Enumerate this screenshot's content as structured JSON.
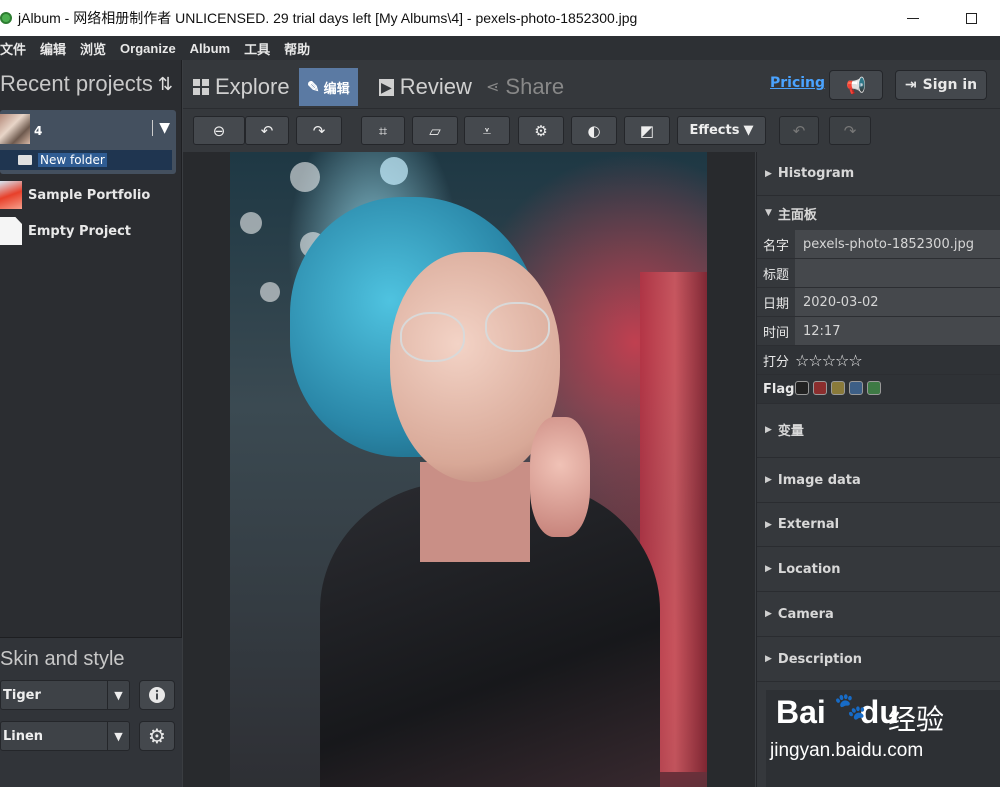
{
  "window": {
    "title": "jAlbum - 网络相册制作者 UNLICENSED. 29 trial days left [My Albums\\4] - pexels-photo-1852300.jpg",
    "minimize": "minimize",
    "maximize": "maximize"
  },
  "menu": [
    "文件",
    "编辑",
    "浏览",
    "Organize",
    "Album",
    "工具",
    "帮助"
  ],
  "left": {
    "header": "Recent projects",
    "projects": [
      {
        "name": "4",
        "thumb": "thumbnail-4"
      },
      {
        "name": "Sample Portfolio"
      },
      {
        "name": "Empty Project"
      }
    ],
    "selected_folder": "New folder",
    "skin_title": "Skin and style",
    "skin": "Tiger",
    "style": "Linen"
  },
  "tabs": {
    "explore": "Explore",
    "edit": "编辑",
    "review": "Review",
    "share": "Share",
    "pricing": "Pricing",
    "signin": "Sign in"
  },
  "editbar": {
    "effects": "Effects"
  },
  "right": {
    "histogram": "Histogram",
    "main_panel": "主面板",
    "rows": {
      "name_label": "名字",
      "name_value": "pexels-photo-1852300.jpg",
      "title_label": "标题",
      "title_value": "",
      "date_label": "日期",
      "date_value": "2020-03-02",
      "time_label": "时间",
      "time_value": "12:17",
      "rating_label": "打分",
      "rating_stars": "☆☆☆☆☆",
      "flag_label": "Flag"
    },
    "flag_colors": [
      "#222222",
      "#8b2e2e",
      "#8a7a3a",
      "#3d5f86",
      "#3e7a45"
    ],
    "sections": [
      "变量",
      "Image data",
      "External",
      "Location",
      "Camera",
      "Description"
    ]
  },
  "watermark": {
    "logo": "Bai",
    "logo2": "du",
    "cn": "经验",
    "url": "jingyan.baidu.com"
  }
}
